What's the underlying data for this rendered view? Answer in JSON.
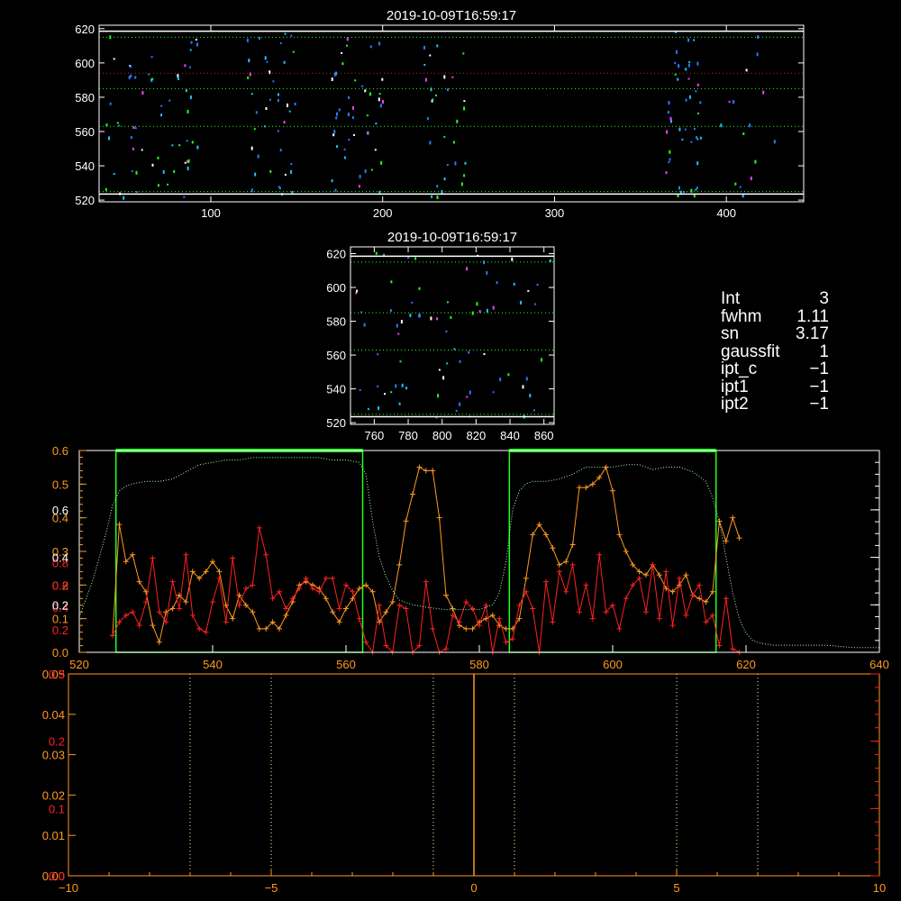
{
  "colors": {
    "background": "#000000",
    "axes_white": "#ffffff",
    "red": "#ff2020",
    "orange": "#ff9a1f",
    "green": "#22ff22",
    "blue": "#2a7bff",
    "cyan": "#19c6ff",
    "magenta": "#ff3cff",
    "light_green_dotted": "#aaffaa",
    "dark_red_dotted": "#b03010"
  },
  "info": [
    {
      "key": "Int",
      "value": "3"
    },
    {
      "key": "fwhm",
      "value": "1.11"
    },
    {
      "key": "sn",
      "value": "3.17"
    },
    {
      "key": "gaussfit",
      "value": "1"
    },
    {
      "key": "ipt_c",
      "value": "−1"
    },
    {
      "key": "ipt1",
      "value": "−1"
    },
    {
      "key": "ipt2",
      "value": "−1"
    }
  ],
  "chart_data": [
    {
      "id": "top-image",
      "type": "heatmap",
      "title": "2019-10-09T16:59:17",
      "xlim": [
        35,
        445
      ],
      "ylim": [
        519,
        622
      ],
      "xticks": [
        "100",
        "200",
        "300",
        "400"
      ],
      "xtick_values": [
        100,
        200,
        300,
        400
      ],
      "yticks": [
        "520",
        "540",
        "560",
        "580",
        "600",
        "620"
      ],
      "ytick_values": [
        520,
        540,
        560,
        580,
        600,
        620
      ],
      "hlines": [
        {
          "y": 618.5,
          "style": "solid",
          "color": "white"
        },
        {
          "y": 615,
          "style": "dotted",
          "color": "green"
        },
        {
          "y": 594,
          "style": "dotted",
          "color": "darkred"
        },
        {
          "y": 585,
          "style": "dotted",
          "color": "green"
        },
        {
          "y": 563,
          "style": "dotted",
          "color": "green"
        },
        {
          "y": 525,
          "style": "dotted",
          "color": "green"
        },
        {
          "y": 523.5,
          "style": "solid",
          "color": "white"
        }
      ],
      "dot_clusters": [
        {
          "x": [
            38,
            92
          ],
          "n": 60
        },
        {
          "x": [
            120,
            150
          ],
          "n": 40
        },
        {
          "x": [
            170,
            200
          ],
          "n": 45
        },
        {
          "x": [
            222,
            248
          ],
          "n": 30
        },
        {
          "x": [
            362,
            385
          ],
          "n": 45
        },
        {
          "x": [
            395,
            432
          ],
          "n": 15
        }
      ]
    },
    {
      "id": "zoom-image",
      "type": "heatmap",
      "title": "2019-10-09T16:59:17",
      "xlim": [
        746,
        866
      ],
      "ylim": [
        519,
        624
      ],
      "xticks": [
        "760",
        "780",
        "800",
        "820",
        "840",
        "860"
      ],
      "xtick_values": [
        760,
        780,
        800,
        820,
        840,
        860
      ],
      "yticks": [
        "520",
        "540",
        "560",
        "580",
        "600",
        "620"
      ],
      "ytick_values": [
        520,
        540,
        560,
        580,
        600,
        620
      ],
      "hlines": [
        {
          "y": 618.5,
          "style": "solid",
          "color": "white"
        },
        {
          "y": 615,
          "style": "dotted",
          "color": "green"
        },
        {
          "y": 585,
          "style": "dotted",
          "color": "green"
        },
        {
          "y": 563,
          "style": "dotted",
          "color": "green"
        },
        {
          "y": 525,
          "style": "dotted",
          "color": "green"
        },
        {
          "y": 523.5,
          "style": "solid",
          "color": "white"
        }
      ],
      "dot_count": 75
    },
    {
      "id": "profile",
      "type": "line",
      "xlim": [
        520,
        640
      ],
      "xticks": [
        "520",
        "540",
        "560",
        "580",
        "600",
        "620",
        "640"
      ],
      "xtick_values": [
        520,
        540,
        560,
        580,
        600,
        620,
        640
      ],
      "ylim_orange": [
        0,
        0.6
      ],
      "ylim_red": [
        0,
        0.6
      ],
      "ylim_cyan": [
        0,
        0.85
      ],
      "yticks_orange": [
        "0.0",
        "0.1",
        "0.2",
        "0.3",
        "0.4",
        "0.5",
        "0.6"
      ],
      "ytick_values_orange": [
        0.0,
        0.1,
        0.2,
        0.3,
        0.4,
        0.5,
        0.6
      ],
      "yticks_red": [
        "0.2",
        "0.4",
        "0.6",
        "0.8"
      ],
      "ytick_values_red": [
        0.0666,
        0.1333,
        0.2,
        0.2666
      ],
      "yticks_cyan": [
        "0.2",
        "0.4",
        "0.6"
      ],
      "ytick_values_cyan": [
        0.2,
        0.4,
        0.6
      ],
      "windows": [
        {
          "x0": 525.5,
          "x1": 562.5
        },
        {
          "x0": 584.5,
          "x1": 615.5
        }
      ],
      "series": [
        {
          "color": "orange",
          "x": [
            525,
            526,
            527,
            528,
            529,
            530,
            531,
            532,
            533,
            534,
            535,
            536,
            537,
            538,
            539,
            540,
            541,
            542,
            543,
            544,
            545,
            546,
            547,
            548,
            549,
            550,
            551,
            552,
            553,
            554,
            555,
            556,
            557,
            558,
            559,
            560,
            561,
            562,
            563,
            564,
            565,
            566,
            567,
            568,
            569,
            570,
            571,
            572,
            573,
            574,
            575,
            576,
            577,
            578,
            579,
            580,
            581,
            582,
            583,
            584,
            585,
            586,
            587,
            588,
            589,
            590,
            591,
            592,
            593,
            594,
            595,
            596,
            597,
            598,
            599,
            600,
            601,
            602,
            603,
            604,
            605,
            606,
            607,
            608,
            609,
            610,
            611,
            612,
            613,
            614,
            615,
            616,
            617,
            618,
            619
          ],
          "y": [
            0.05,
            0.38,
            0.27,
            0.29,
            0.21,
            0.18,
            0.08,
            0.03,
            0.12,
            0.13,
            0.17,
            0.15,
            0.24,
            0.22,
            0.24,
            0.27,
            0.24,
            0.14,
            0.1,
            0.17,
            0.14,
            0.12,
            0.07,
            0.07,
            0.09,
            0.07,
            0.11,
            0.15,
            0.2,
            0.21,
            0.2,
            0.19,
            0.16,
            0.12,
            0.09,
            0.13,
            0.16,
            0.19,
            0.2,
            0.18,
            0.09,
            0.12,
            0.15,
            0.26,
            0.39,
            0.47,
            0.55,
            0.54,
            0.54,
            0.4,
            0.17,
            0.13,
            0.08,
            0.07,
            0.07,
            0.09,
            0.1,
            0.11,
            0.08,
            0.07,
            0.07,
            0.1,
            0.22,
            0.35,
            0.38,
            0.35,
            0.31,
            0.26,
            0.27,
            0.32,
            0.49,
            0.49,
            0.5,
            0.52,
            0.55,
            0.48,
            0.35,
            0.3,
            0.26,
            0.24,
            0.23,
            0.26,
            0.23,
            0.19,
            0.18,
            0.2,
            0.23,
            0.17,
            0.16,
            0.15,
            0.18,
            0.39,
            0.33,
            0.4,
            0.34
          ]
        },
        {
          "color": "red",
          "x": [
            525,
            526,
            527,
            528,
            529,
            530,
            531,
            532,
            533,
            534,
            535,
            536,
            537,
            538,
            539,
            540,
            541,
            542,
            543,
            544,
            545,
            546,
            547,
            548,
            549,
            550,
            551,
            552,
            553,
            554,
            555,
            556,
            557,
            558,
            559,
            560,
            561,
            562,
            563,
            564,
            565,
            566,
            567,
            568,
            569,
            570,
            571,
            572,
            573,
            574,
            575,
            576,
            577,
            578,
            579,
            580,
            581,
            582,
            583,
            584,
            585,
            586,
            587,
            588,
            589,
            590,
            591,
            592,
            593,
            594,
            595,
            596,
            597,
            598,
            599,
            600,
            601,
            602,
            603,
            604,
            605,
            606,
            607,
            608,
            609,
            610,
            611,
            612,
            613,
            614,
            615,
            616,
            617,
            618,
            619
          ],
          "y": [
            0.05,
            0.09,
            0.11,
            0.12,
            0.08,
            0.15,
            0.28,
            0.12,
            0.09,
            0.21,
            0.13,
            0.29,
            0.11,
            0.07,
            0.06,
            0.15,
            0.22,
            0.09,
            0.28,
            0.14,
            0.19,
            0.2,
            0.37,
            0.29,
            0.16,
            0.18,
            0.13,
            0.16,
            0.19,
            0.22,
            0.19,
            0.18,
            0.22,
            0.22,
            0.13,
            0.2,
            0.18,
            0.1,
            0.03,
            0.0,
            0.14,
            0.02,
            0.0,
            0.14,
            0.13,
            0.0,
            0.02,
            0.21,
            0.07,
            0.0,
            0.01,
            0.11,
            0.09,
            0.15,
            0.13,
            0.08,
            0.14,
            0.0,
            0.1,
            0.03,
            0.04,
            0.14,
            0.18,
            0.13,
            0.0,
            0.21,
            0.09,
            0.24,
            0.18,
            0.26,
            0.12,
            0.2,
            0.1,
            0.29,
            0.12,
            0.14,
            0.07,
            0.16,
            0.2,
            0.22,
            0.12,
            0.26,
            0.1,
            0.24,
            0.08,
            0.22,
            0.11,
            0.17,
            0.2,
            0.09,
            0.11,
            0.02,
            0.16,
            0.01,
            0.0
          ]
        },
        {
          "color": "light_green_dotted",
          "x": [
            520,
            522,
            524,
            525,
            526,
            527,
            528,
            530,
            532,
            534,
            536,
            538,
            540,
            542,
            544,
            546,
            548,
            550,
            552,
            554,
            556,
            558,
            560,
            562,
            563,
            564,
            565,
            566,
            567,
            568,
            570,
            572,
            575,
            578,
            580,
            582,
            583,
            584,
            585,
            586,
            587,
            588,
            590,
            592,
            594,
            596,
            598,
            600,
            602,
            604,
            606,
            608,
            610,
            612,
            614,
            615,
            616,
            617,
            618,
            619,
            620,
            621,
            622,
            624,
            628,
            632,
            636,
            640
          ],
          "y": [
            0.15,
            0.3,
            0.5,
            0.62,
            0.68,
            0.7,
            0.71,
            0.72,
            0.72,
            0.73,
            0.76,
            0.79,
            0.8,
            0.81,
            0.81,
            0.82,
            0.82,
            0.82,
            0.82,
            0.82,
            0.82,
            0.81,
            0.81,
            0.8,
            0.75,
            0.55,
            0.4,
            0.32,
            0.26,
            0.22,
            0.2,
            0.19,
            0.18,
            0.18,
            0.18,
            0.2,
            0.25,
            0.38,
            0.6,
            0.68,
            0.71,
            0.72,
            0.72,
            0.73,
            0.75,
            0.78,
            0.78,
            0.78,
            0.79,
            0.79,
            0.77,
            0.78,
            0.78,
            0.76,
            0.72,
            0.65,
            0.55,
            0.4,
            0.25,
            0.14,
            0.08,
            0.05,
            0.04,
            0.03,
            0.03,
            0.03,
            0.02,
            0.02
          ]
        }
      ]
    },
    {
      "id": "residuals",
      "type": "line",
      "xlim": [
        -10,
        10
      ],
      "xticks": [
        "−10",
        "−5",
        "0",
        "5",
        "10"
      ],
      "xtick_values": [
        -10,
        -5,
        0,
        5,
        10
      ],
      "yticks_orange": [
        "0.00",
        "0.01",
        "0.02",
        "0.03",
        "0.04",
        "0.05"
      ],
      "ytick_values_orange": [
        0.0,
        0.01,
        0.02,
        0.03,
        0.04,
        0.05
      ],
      "yticks_red": [
        "0.0",
        "0.1",
        "0.2",
        "0.3"
      ],
      "ytick_values_red": [
        0.0,
        0.01666,
        0.03333,
        0.05
      ],
      "ylim": [
        0,
        0.05
      ],
      "vlines_dotted": [
        -7,
        -5,
        -1,
        1,
        5,
        7
      ],
      "vline_solid": 0
    }
  ]
}
